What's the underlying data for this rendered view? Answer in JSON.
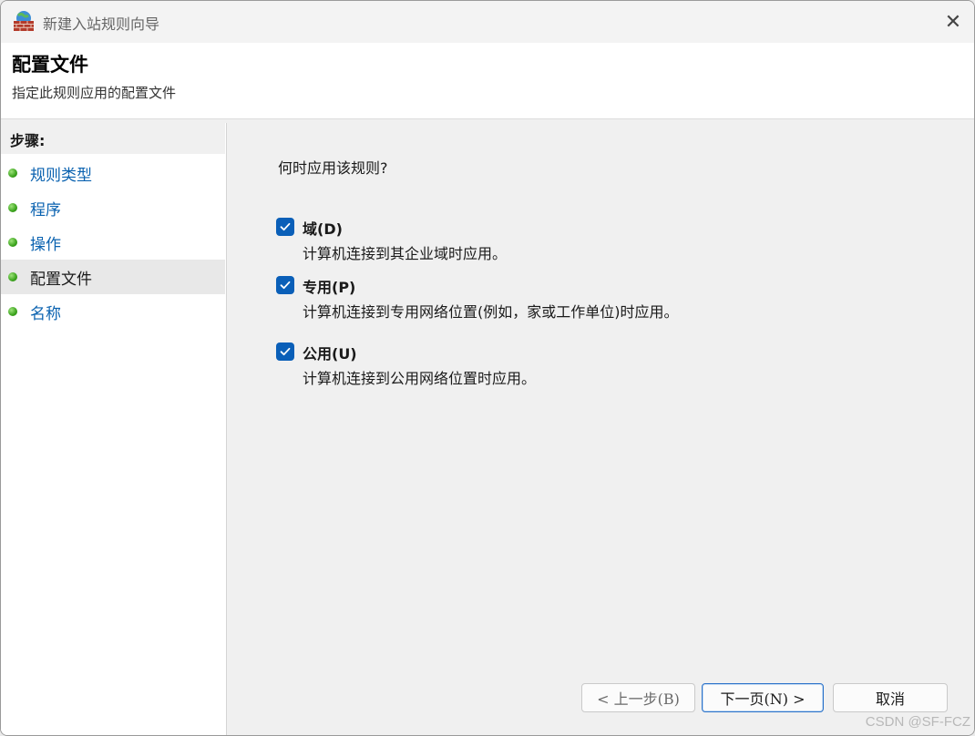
{
  "window": {
    "title": "新建入站规则向导",
    "close_glyph": "✕"
  },
  "header": {
    "title": "配置文件",
    "subtitle": "指定此规则应用的配置文件"
  },
  "sidebar": {
    "heading": "步骤:",
    "items": [
      {
        "label": "规则类型",
        "state": "link"
      },
      {
        "label": "程序",
        "state": "link"
      },
      {
        "label": "操作",
        "state": "link"
      },
      {
        "label": "配置文件",
        "state": "current"
      },
      {
        "label": "名称",
        "state": "link"
      }
    ]
  },
  "main": {
    "question": "何时应用该规则?",
    "options": [
      {
        "label": "域(D)",
        "description": "计算机连接到其企业域时应用。",
        "checked": true
      },
      {
        "label": "专用(P)",
        "description": "计算机连接到专用网络位置(例如，家或工作单位)时应用。",
        "checked": true
      },
      {
        "label": "公用(U)",
        "description": "计算机连接到公用网络位置时应用。",
        "checked": true
      }
    ]
  },
  "buttons": {
    "back": "< 上一步(B)",
    "next": "下一页(N) >",
    "cancel": "取消"
  },
  "watermark": "CSDN @SF-FCZ",
  "colors": {
    "checkbox": "#0a5fb8",
    "link": "#0a62b0",
    "step_dot": "#3aa31c"
  }
}
